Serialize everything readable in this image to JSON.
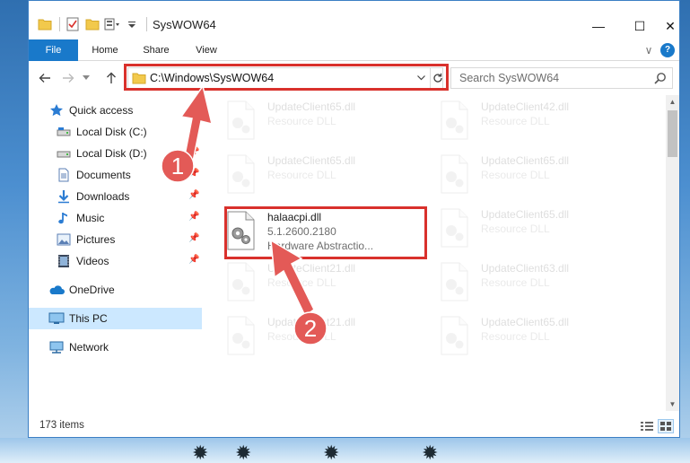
{
  "window": {
    "title": "SysWOW64",
    "minimize_glyph": "—",
    "maximize_glyph": "☐",
    "close_glyph": "✕"
  },
  "ribbon": {
    "tabs": [
      {
        "label": "File"
      },
      {
        "label": "Home"
      },
      {
        "label": "Share"
      },
      {
        "label": "View"
      }
    ],
    "expand_glyph": "∨",
    "help_glyph": "?"
  },
  "address": {
    "path": "C:\\Windows\\SysWOW64",
    "search_placeholder": "Search SysWOW64"
  },
  "nav": {
    "items": [
      {
        "label": "Quick access",
        "icon": "star-icon"
      },
      {
        "label": "Local Disk (C:)",
        "icon": "drive-icon",
        "pinned": true
      },
      {
        "label": "Local Disk (D:)",
        "icon": "drive-icon",
        "pinned": true
      },
      {
        "label": "Documents",
        "icon": "documents-icon",
        "pinned": true
      },
      {
        "label": "Downloads",
        "icon": "downloads-icon",
        "pinned": true
      },
      {
        "label": "Music",
        "icon": "music-icon",
        "pinned": true
      },
      {
        "label": "Pictures",
        "icon": "pictures-icon",
        "pinned": true
      },
      {
        "label": "Videos",
        "icon": "videos-icon",
        "pinned": true
      },
      {
        "label": "OneDrive",
        "icon": "onedrive-icon"
      },
      {
        "label": "This PC",
        "icon": "pc-icon",
        "selected": true
      },
      {
        "label": "Network",
        "icon": "network-icon"
      }
    ]
  },
  "files": {
    "col1": [
      {
        "name": "UpdateClient65.dll",
        "line2": "Resource DLL",
        "line3": ""
      },
      {
        "name": "UpdateClient65.dll",
        "line2": "Resource DLL",
        "line3": ""
      },
      {
        "name": "halaacpi.dll",
        "line2": "5.1.2600.2180",
        "line3": "Hardware Abstractio..."
      },
      {
        "name": "UpdateClient21.dll",
        "line2": "Resource DLL",
        "line3": ""
      },
      {
        "name": "UpdateClient21.dll",
        "line2": "Resource DLL",
        "line3": ""
      }
    ],
    "col2": [
      {
        "name": "UpdateClient42.dll",
        "line2": "Resource DLL",
        "line3": ""
      },
      {
        "name": "UpdateClient65.dll",
        "line2": "Resource DLL",
        "line3": ""
      },
      {
        "name": "UpdateClient65.dll",
        "line2": "Resource DLL",
        "line3": ""
      },
      {
        "name": "UpdateClient63.dll",
        "line2": "Resource DLL",
        "line3": ""
      },
      {
        "name": "UpdateClient65.dll",
        "line2": "Resource DLL",
        "line3": ""
      }
    ]
  },
  "status": {
    "item_count": "173 items"
  },
  "annotations": {
    "step1": "1",
    "step2": "2",
    "color": "#d9312c"
  },
  "colors": {
    "accent": "#1979ca",
    "selected_bg": "#cce8ff"
  }
}
